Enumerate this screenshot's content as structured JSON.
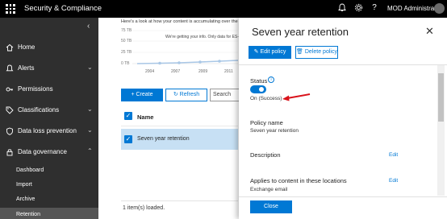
{
  "topbar": {
    "app_title": "Security & Compliance",
    "user_name": "MOD Administrator",
    "icons": [
      "bell-icon",
      "gear-icon",
      "help-icon"
    ]
  },
  "sidebar": {
    "items": [
      {
        "label": "Home",
        "icon": "home-icon"
      },
      {
        "label": "Alerts",
        "icon": "alert-icon"
      },
      {
        "label": "Permissions",
        "icon": "key-icon"
      },
      {
        "label": "Classifications",
        "icon": "tag-icon"
      },
      {
        "label": "Data loss prevention",
        "icon": "shield-icon"
      },
      {
        "label": "Data governance",
        "icon": "lock-icon"
      }
    ],
    "sub_items": [
      {
        "label": "Dashboard"
      },
      {
        "label": "Import"
      },
      {
        "label": "Archive"
      },
      {
        "label": "Retention"
      }
    ]
  },
  "main": {
    "chart_intro": "Here's a look at how your content is accumulating over the ye",
    "chart_note": "We're getting your info. Only data for ES-",
    "chart_data": {
      "type": "line",
      "x": [
        "2004",
        "2007",
        "2009",
        "2011"
      ],
      "yticks": [
        "75 TB",
        "50 TB",
        "25 TB",
        "0 TB"
      ]
    },
    "create_label": "+ Create",
    "refresh_label": "Refresh",
    "search_placeholder": "Search",
    "table": {
      "header": "Name",
      "rows": [
        {
          "name": "Seven year retention"
        }
      ]
    },
    "items_loaded": "1 item(s) loaded."
  },
  "panel": {
    "title": "Seven year retention",
    "edit_policy": "Edit policy",
    "delete_policy": "Delete policy",
    "status_label": "Status",
    "status_value": "On (Success)",
    "policy_name_label": "Policy name",
    "policy_name_value": "Seven year retention",
    "description_label": "Description",
    "applies_label": "Applies to content in these locations",
    "applies_value": "Exchange email",
    "edit_link": "Edit",
    "close_button": "Close"
  },
  "colors": {
    "accent": "#0078d4",
    "arrow": "#d9121a",
    "sidebar": "#2f2f2f",
    "topbar": "#000000"
  }
}
